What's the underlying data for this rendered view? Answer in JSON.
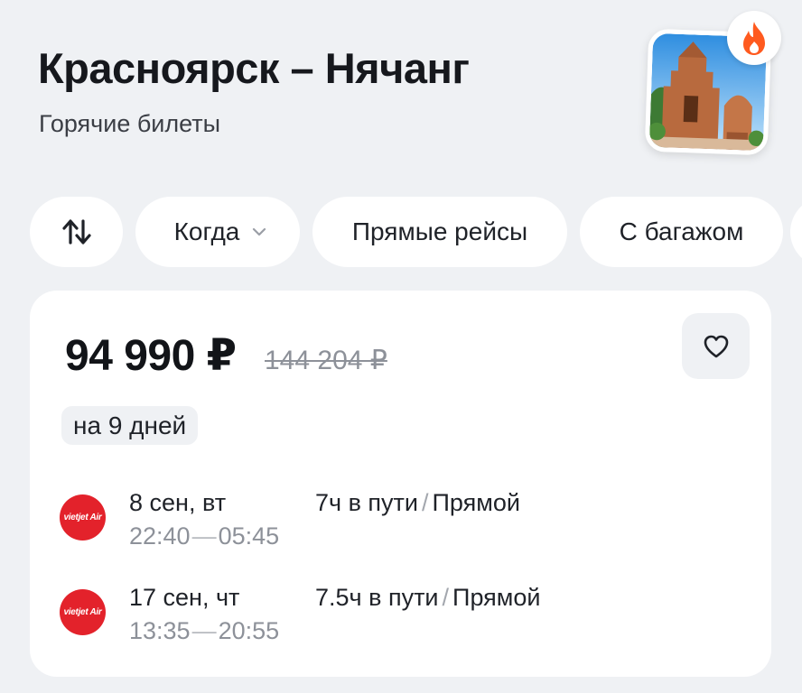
{
  "header": {
    "title": "Красноярск – Нячанг",
    "subtitle": "Горячие билеты",
    "thumbnail_icon": "temple-photo",
    "badge_icon": "fire-icon"
  },
  "filters": {
    "sort_icon": "swap-vertical-icon",
    "when_label": "Когда",
    "when_icon": "chevron-down-icon",
    "direct_label": "Прямые рейсы",
    "baggage_label": "С багажом"
  },
  "offer": {
    "price": "94 990 ₽",
    "old_price": "144 204 ₽",
    "duration_tag": "на 9 дней",
    "favorite_icon": "heart-icon",
    "flights": [
      {
        "airline_logo_text": "vietjet Air",
        "date": "8 сен, вт",
        "departure": "22:40",
        "arrival": "05:45",
        "travel_time": "7ч в пути",
        "stops": "Прямой"
      },
      {
        "airline_logo_text": "vietjet Air",
        "date": "17 сен, чт",
        "departure": "13:35",
        "arrival": "20:55",
        "travel_time": "7.5ч в пути",
        "stops": "Прямой"
      }
    ]
  },
  "colors": {
    "background": "#eff1f4",
    "card": "#ffffff",
    "airline_red": "#e3222b",
    "fire_orange": "#ff5a1f",
    "muted_text": "#8d9199"
  }
}
